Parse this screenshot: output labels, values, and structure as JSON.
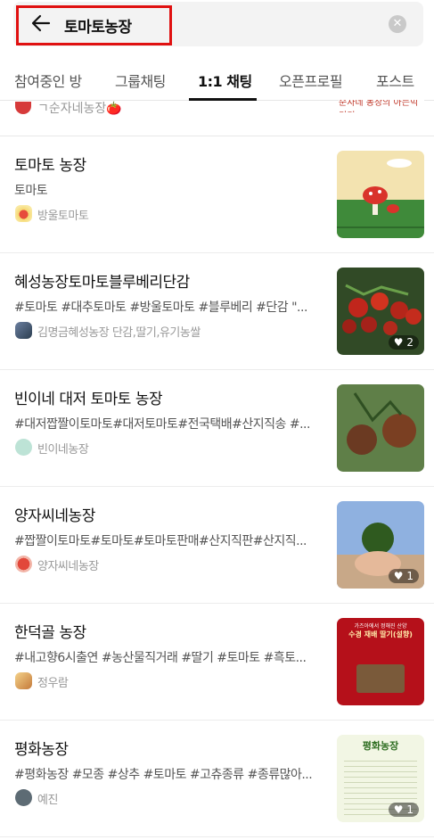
{
  "search": {
    "query": "토마토농장",
    "clear_icon": "clear-icon"
  },
  "tabs": [
    {
      "label": "참여중인 방"
    },
    {
      "label": "그룹채팅"
    },
    {
      "label": "1:1 채팅",
      "active": true
    },
    {
      "label": "오픈프로필"
    },
    {
      "label": "포스트"
    }
  ],
  "partial_item": {
    "owner": "ㄱ순자네농장🍅",
    "thumb_text": "순자네 농장의 아는빅기키"
  },
  "items": [
    {
      "title": "토마토 농장",
      "desc": "토마토",
      "owner": "방울토마토",
      "likes": ""
    },
    {
      "title": "혜성농장토마토블루베리단감",
      "desc": "#토마토 #대추토마토 #방울토마토 #블루베리 #단감 \"...",
      "owner": "김명금혜성농장 단감,딸기,유기농쌀",
      "likes": "2"
    },
    {
      "title": "빈이네 대저 토마토 농장",
      "desc": "#대저짭짤이토마토#대저토마토#전국택배#산지직송 #...",
      "owner": "빈이네농장",
      "likes": ""
    },
    {
      "title": "양자씨네농장",
      "desc": "#짭짤이토마토#토마토#토마토판매#산지직판#산지직...",
      "owner": "양자씨네농장",
      "likes": "1"
    },
    {
      "title": "한덕골 농장",
      "desc": "#내고향6시출연 #농산물직거래 #딸기 #토마토 #흑토...",
      "owner": "정우람",
      "likes": ""
    },
    {
      "title": "평화농장",
      "desc": "#평화농장 #모종 #상추 #토마토 #고츄종류 #종류많아...",
      "owner": "예진",
      "likes": "1"
    }
  ],
  "thumb4": {
    "line1": "가즈아에서 정해진 산양",
    "line2": "수경 재배 딸기(설향)"
  },
  "thumb5": {
    "title": "평화농장"
  }
}
